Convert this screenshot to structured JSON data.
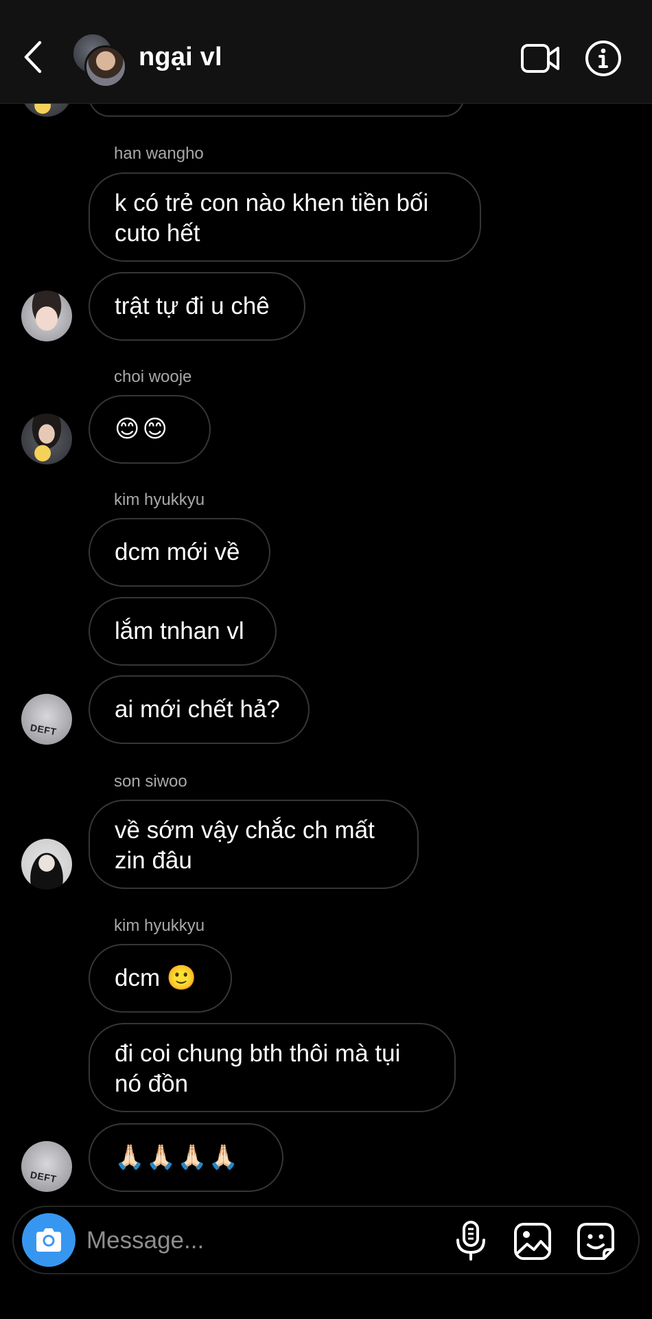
{
  "header": {
    "title": "ngại vl",
    "back_icon": "chevron-left-icon",
    "video_icon": "video-camera-icon",
    "info_icon": "info-icon"
  },
  "messages": [
    {
      "sender": "han wangho",
      "texts": [
        "k có trẻ con nào khen tiền bối\ncuto hết",
        "trật tự đi u chê"
      ]
    },
    {
      "sender": "choi wooje",
      "texts": [
        "😊😊"
      ]
    },
    {
      "sender": "kim hyukkyu",
      "texts": [
        "dcm mới về",
        "lắm tnhan vl",
        "ai mới chết hả?"
      ]
    },
    {
      "sender": "son siwoo",
      "texts": [
        "về sớm vậy chắc ch mất\nzin đâu"
      ]
    },
    {
      "sender": "kim hyukkyu",
      "texts": [
        "dcm 🙂",
        "đi coi chung bth thôi mà tụi\nnó đồn",
        "🙏🏻🙏🏻🙏🏻🙏🏻"
      ]
    }
  ],
  "avatars": {
    "deft_text": "DEFT"
  },
  "composer": {
    "placeholder": "Message...",
    "camera_icon": "camera-icon",
    "mic_icon": "microphone-icon",
    "gallery_icon": "image-gallery-icon",
    "sticker_icon": "sticker-icon"
  },
  "colors": {
    "background": "#000000",
    "header_background": "#121212",
    "bubble_border": "#363636",
    "sender_text": "#a8a8a8",
    "accent": "#3797f0"
  }
}
